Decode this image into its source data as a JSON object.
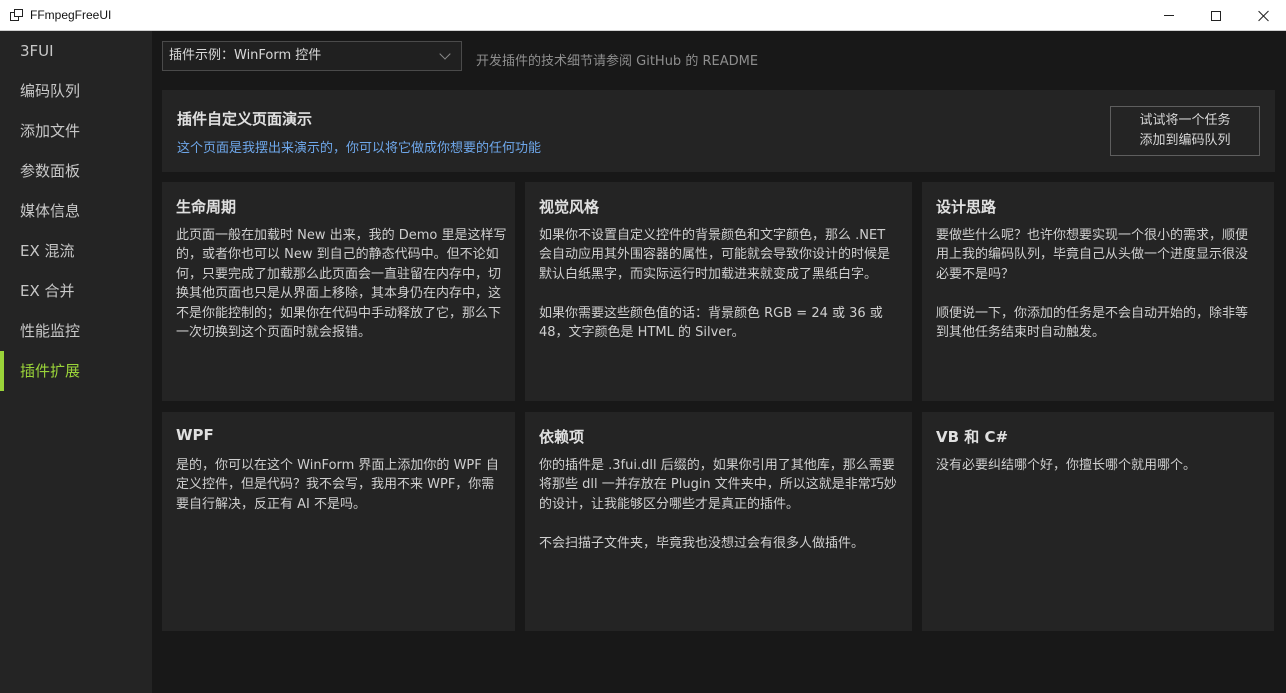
{
  "window": {
    "title": "FFmpegFreeUI"
  },
  "sidebar": {
    "items": [
      {
        "label": "3FUI"
      },
      {
        "label": "编码队列"
      },
      {
        "label": "添加文件"
      },
      {
        "label": "参数面板"
      },
      {
        "label": "媒体信息"
      },
      {
        "label": "EX 混流"
      },
      {
        "label": "EX 合并"
      },
      {
        "label": "性能监控"
      },
      {
        "label": "插件扩展",
        "active": true
      }
    ],
    "accent_color": "#9ad339"
  },
  "toolbar": {
    "plugin_select_value": "插件示例：WinForm 控件",
    "hint": "开发插件的技术细节请参阅 GitHub 的 README"
  },
  "header": {
    "title": "插件自定义页面演示",
    "subtitle": "这个页面是我摆出来演示的，你可以将它做成你想要的任何功能",
    "button_line1": "试试将一个任务",
    "button_line2": "添加到编码队列"
  },
  "cards": [
    {
      "title": "生命周期",
      "body": "此页面一般在加载时 New 出来，我的 Demo 里是这样写的，或者你也可以 New 到自己的静态代码中。但不论如何，只要完成了加载那么此页面会一直驻留在内存中，切换其他页面也只是从界面上移除，其本身仍在内存中，这不是你能控制的；如果你在代码中手动释放了它，那么下一次切换到这个页面时就会报错。"
    },
    {
      "title": "视觉风格",
      "body": "如果你不设置自定义控件的背景颜色和文字颜色，那么 .NET 会自动应用其外围容器的属性，可能就会导致你设计的时候是默认白纸黑字，而实际运行时加载进来就变成了黑纸白字。\n\n如果你需要这些颜色值的话：背景颜色 RGB = 24 或 36 或 48，文字颜色是 HTML 的 Silver。"
    },
    {
      "title": "设计思路",
      "body": "要做些什么呢？也许你想要实现一个很小的需求，顺便用上我的编码队列，毕竟自己从头做一个进度显示很没必要不是吗？\n\n顺便说一下，你添加的任务是不会自动开始的，除非等到其他任务结束时自动触发。"
    },
    {
      "title": "WPF",
      "body": "是的，你可以在这个 WinForm 界面上添加你的 WPF 自定义控件，但是代码？我不会写，我用不来 WPF，你需要自行解决，反正有 AI 不是吗。"
    },
    {
      "title": "依赖项",
      "body": "你的插件是 .3fui.dll 后缀的，如果你引用了其他库，那么需要将那些 dll 一并存放在 Plugin 文件夹中，所以这就是非常巧妙的设计，让我能够区分哪些才是真正的插件。\n\n不会扫描子文件夹，毕竟我也没想过会有很多人做插件。"
    },
    {
      "title": "VB 和 C#",
      "body": "没有必要纠结哪个好，你擅长哪个就用哪个。"
    }
  ],
  "colors": {
    "background": "#181818",
    "panel": "#242424",
    "text": "#c0c0c0",
    "link": "#6ea7ea"
  }
}
